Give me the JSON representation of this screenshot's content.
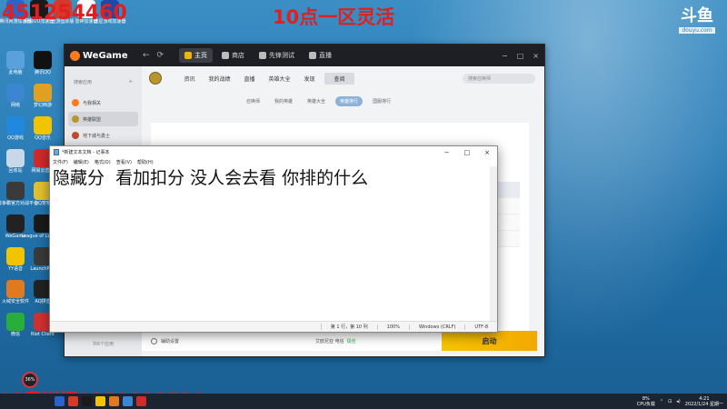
{
  "overlay": {
    "stream_title": "10点一区灵活",
    "top_left_number": "451254460",
    "bottom_text": "JG青训招1379038730",
    "douyu_mark": "斗鱼",
    "douyu_url": "douyu.com"
  },
  "desktop_icons": [
    {
      "label": "腾讯网游加速器",
      "color": "#2a64c8"
    },
    {
      "label": "网易UU加速器",
      "color": "#1a1a1a"
    },
    {
      "label": "迅游国际版",
      "color": "#d43a2a"
    },
    {
      "label": "雷神加速器",
      "color": "#ffffff"
    },
    {
      "label": "流星游戏加速器",
      "color": "#1d4aa8"
    },
    {
      "label": "此电脑",
      "color": "#5aa0dc"
    },
    {
      "label": "腾讯QQ",
      "color": "#111111"
    },
    {
      "label": "网络",
      "color": "#3a86d0"
    },
    {
      "label": "梦幻西游",
      "color": "#e0a020"
    },
    {
      "label": "QQ游戏",
      "color": "#2288dd"
    },
    {
      "label": "QQ音乐",
      "color": "#f2c400"
    },
    {
      "label": "回收站",
      "color": "#c8d8e8"
    },
    {
      "label": "网易云音乐",
      "color": "#d02a2a"
    },
    {
      "label": "魔兽争霸官方对战平台",
      "color": "#3a3a3a"
    },
    {
      "label": "QQ宠物",
      "color": "#e0c030"
    },
    {
      "label": "WeGame",
      "color": "#222222"
    },
    {
      "label": "League of Legends",
      "color": "#1a1a1a"
    },
    {
      "label": "YY语音",
      "color": "#f2c400"
    },
    {
      "label": "LaunchPad",
      "color": "#3a3a3a"
    },
    {
      "label": "火绒安全软件",
      "color": "#e07a20"
    },
    {
      "label": "AQ拼音",
      "color": "#222222"
    },
    {
      "label": "微信",
      "color": "#2aae3a"
    },
    {
      "label": "Riot Client",
      "color": "#d23030"
    }
  ],
  "wegame": {
    "brand": "WeGame",
    "back": "←",
    "refresh": "⟳",
    "tabs": [
      {
        "label": "主页",
        "active": true
      },
      {
        "label": "商店",
        "active": false
      },
      {
        "label": "先锋测试",
        "active": false
      },
      {
        "label": "直播",
        "active": false
      }
    ],
    "window_controls": [
      "−",
      "□",
      "×"
    ],
    "sidebar": {
      "search_placeholder": "搜索应用",
      "add": "+",
      "items": [
        {
          "label": "与我相关",
          "color": "#ff7a1a",
          "active": false
        },
        {
          "label": "英雄联盟",
          "color": "#b8962e",
          "active": true
        },
        {
          "label": "地下城与勇士",
          "color": "#c24a2a",
          "active": false
        }
      ],
      "bottom_label": "共6个应用"
    },
    "main_nav": [
      {
        "label": "资讯",
        "active": false
      },
      {
        "label": "我的战绩",
        "active": false
      },
      {
        "label": "直播",
        "active": false
      },
      {
        "label": "英雄大全",
        "active": false
      },
      {
        "label": "发现",
        "active": false
      },
      {
        "label": "查阅",
        "active": true
      }
    ],
    "main_search_placeholder": "搜索召唤师",
    "sub_tabs": [
      {
        "label": "召唤师",
        "active": false
      },
      {
        "label": "我的英雄",
        "active": false
      },
      {
        "label": "英雄大全",
        "active": false
      },
      {
        "label": "英雄排行",
        "active": true
      },
      {
        "label": "国服排行",
        "active": false
      }
    ],
    "bottom": {
      "settings_label": "辅助设置",
      "status_label": "艾欧尼亚 电信",
      "status_badge": "极佳",
      "launch_label": "启动"
    }
  },
  "notepad": {
    "title": "*新建文本文档 - 记事本",
    "menu": [
      "文件(F)",
      "编辑(E)",
      "格式(O)",
      "查看(V)",
      "帮助(H)"
    ],
    "controls": [
      "−",
      "□",
      "×"
    ],
    "content": "隐藏分  看加扣分 没人会去看 你排的什么",
    "status": {
      "position": "第 1 行，第 10 列",
      "zoom": "100%",
      "line_ending": "Windows (CRLF)",
      "encoding": "UTF-8"
    }
  },
  "taskbar": {
    "cpu_value": "8%",
    "cpu_label": "CPU负载",
    "time": "4:21",
    "date": "2022/1/24 星期一",
    "gauge_value": "36%",
    "app_colors": [
      "#2a64c8",
      "#d43a2a",
      "#1a1a1a",
      "#f2c400",
      "#e07a20",
      "#3a86d0",
      "#d02a2a"
    ]
  }
}
